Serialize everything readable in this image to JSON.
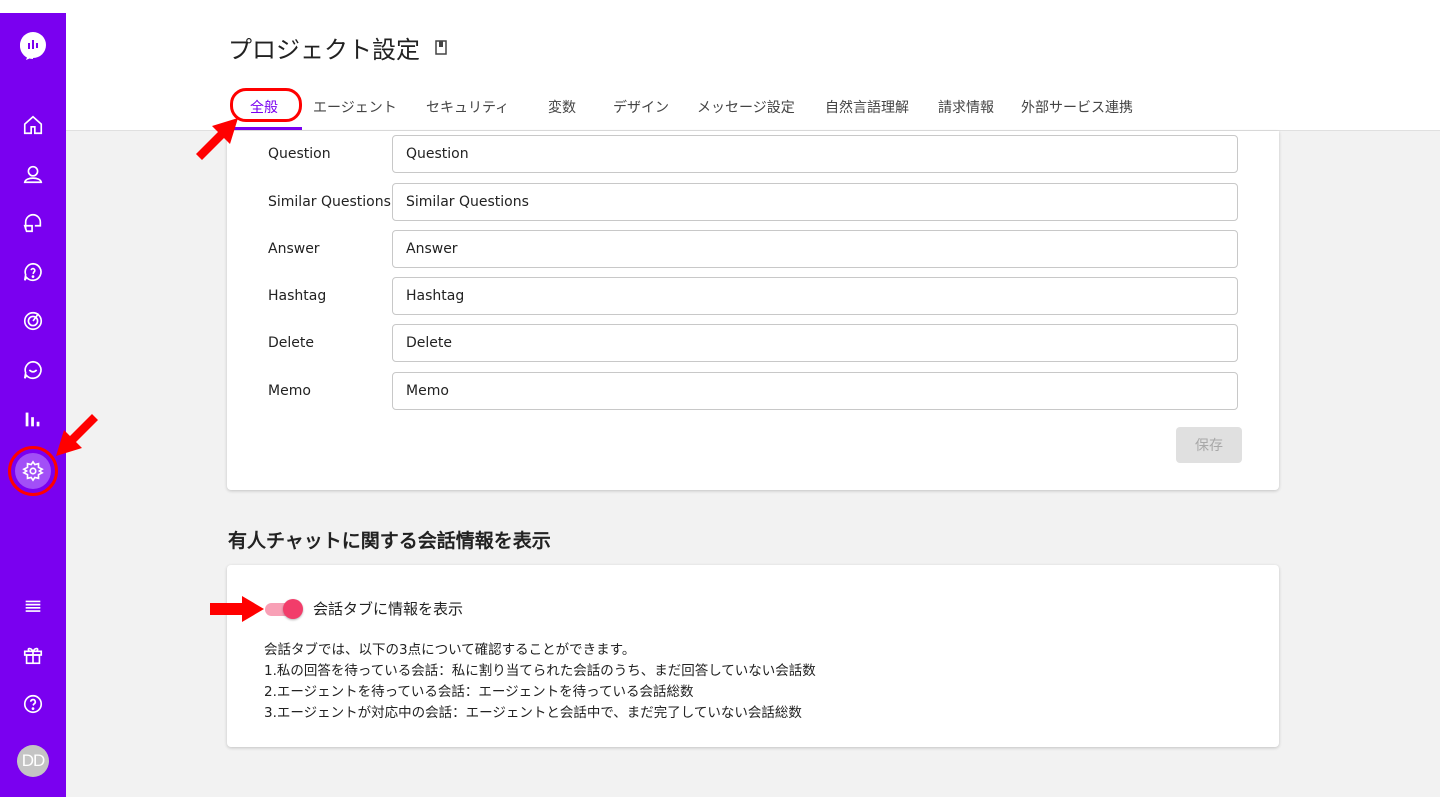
{
  "header": {
    "title": "プロジェクト設定"
  },
  "tabs": [
    {
      "label": "全般",
      "active": true
    },
    {
      "label": "エージェント"
    },
    {
      "label": "セキュリティ"
    },
    {
      "label": "変数"
    },
    {
      "label": "デザイン"
    },
    {
      "label": "メッセージ設定"
    },
    {
      "label": "自然言語理解"
    },
    {
      "label": "請求情報"
    },
    {
      "label": "外部サービス連携"
    }
  ],
  "fields": [
    {
      "label": "Question",
      "value": "Question"
    },
    {
      "label": "Similar Questions",
      "value": "Similar Questions"
    },
    {
      "label": "Answer",
      "value": "Answer"
    },
    {
      "label": "Hashtag",
      "value": "Hashtag"
    },
    {
      "label": "Delete",
      "value": "Delete"
    },
    {
      "label": "Memo",
      "value": "Memo"
    }
  ],
  "save_label": "保存",
  "section": {
    "title": "有人チャットに関する会話情報を表示",
    "toggle_label": "会話タブに情報を表示",
    "toggle_on": true,
    "desc": [
      "会話タブでは、以下の3点について確認することができます。",
      "1.私の回答を待っている会話：私に割り当てられた会話のうち、まだ回答していない会話数",
      "2.エージェントを待っている会話：エージェントを待っている会話総数",
      "3.エージェントが対応中の会話：エージェントと会話中で、まだ完了していない会話総数"
    ]
  },
  "sidebar": {
    "icons": [
      "home-icon",
      "user-icon",
      "chat-icon",
      "faq-icon",
      "target-icon",
      "message-icon",
      "analytics-icon",
      "settings-icon",
      "menu-icon",
      "gift-icon",
      "help-icon"
    ],
    "avatar": "DD"
  },
  "colors": {
    "brand": "#7a00f0",
    "toggle": "#f23d6a",
    "highlight": "#ff0000"
  }
}
